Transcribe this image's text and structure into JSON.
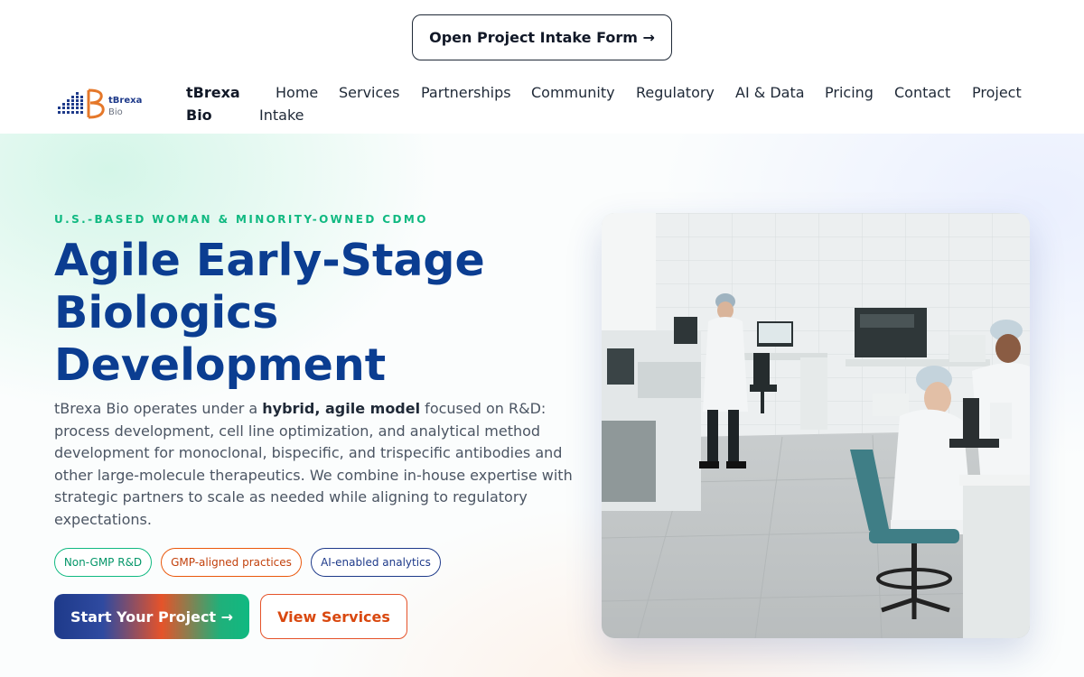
{
  "topbar": {
    "intake_button": "Open Project Intake Form →"
  },
  "header": {
    "logo_text_top": "tBrexa",
    "logo_text_bottom": "Bio",
    "brand_line1": "tBrexa",
    "brand_line2": "Bio",
    "nav": {
      "home": "Home",
      "services": "Services",
      "partnerships": "Partnerships",
      "community": "Community",
      "regulatory": "Regulatory",
      "ai_data": "AI & Data",
      "pricing": "Pricing",
      "contact": "Contact",
      "project": "Project",
      "intake": "Intake"
    }
  },
  "hero": {
    "eyebrow": "U.S.-BASED WOMAN & MINORITY-OWNED CDMO",
    "title_line1": "Agile Early-Stage",
    "title_line2": "Biologics",
    "title_line3": "Development",
    "desc_part1": "tBrexa Bio operates under a ",
    "desc_bold": "hybrid, agile model",
    "desc_part2": " focused on R&D: process development, cell line optimization, and analytical method development for monoclonal, bispecific, and trispecific antibodies and other large-molecule therapeutics. We combine in-house expertise with strategic partners to scale as needed while aligning to regulatory expectations.",
    "chips": {
      "non_gmp": "Non-GMP R&D",
      "gmp_aligned": "GMP-aligned practices",
      "ai_enabled": "AI-enabled analytics"
    },
    "start_button": "Start Your Project →",
    "services_button": "View Services"
  },
  "colors": {
    "brand_blue": "#0b3d91",
    "accent_green": "#10b981",
    "accent_orange": "#e5532a"
  }
}
